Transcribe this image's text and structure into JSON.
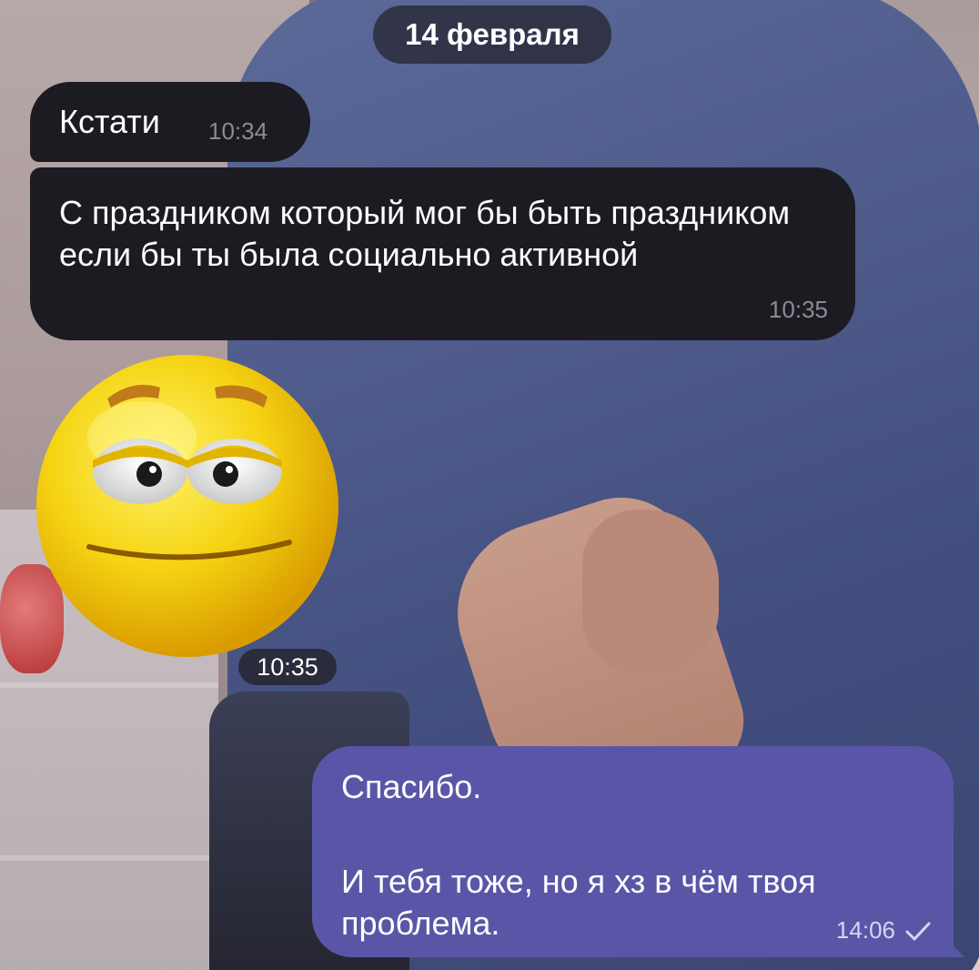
{
  "chat": {
    "date_separator": "14 февраля",
    "messages": [
      {
        "direction": "incoming",
        "text": "Кстати",
        "time": "10:34"
      },
      {
        "direction": "incoming",
        "text": "С праздником который мог бы быть праздником если бы ты была социально активной",
        "time": "10:35"
      },
      {
        "direction": "incoming",
        "type": "sticker",
        "sticker": "smirking-emoji-face",
        "time": "10:35"
      },
      {
        "direction": "outgoing",
        "line1": "Спасибо.",
        "line2": "И тебя тоже, но я хз в чём твоя проблема.",
        "time": "14:06",
        "status_icon": "check-icon"
      }
    ]
  },
  "colors": {
    "incoming_bubble": "#1d1b22",
    "outgoing_bubble": "#5a56a7",
    "timestamp_incoming": "#8d8a94"
  }
}
